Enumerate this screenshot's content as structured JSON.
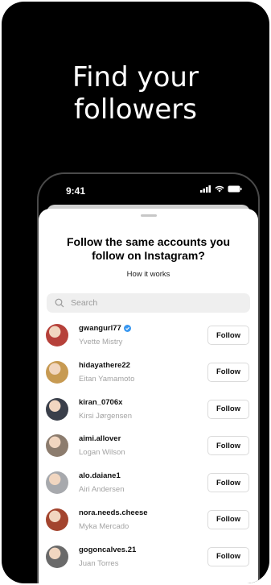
{
  "promo": {
    "headline_line1": "Find your",
    "headline_line2": "followers"
  },
  "status_bar": {
    "time": "9:41"
  },
  "sheet": {
    "title_line1": "Follow the same accounts you",
    "title_line2": "follow on Instagram?",
    "how_it_works": "How it works",
    "search_placeholder": "Search"
  },
  "accounts": [
    {
      "username": "gwangurl77",
      "name": "Yvette Mistry",
      "verified": true,
      "button": "Follow",
      "avatar_color": "#b6413a"
    },
    {
      "username": "hidayathere22",
      "name": "Eitan Yamamoto",
      "verified": false,
      "button": "Follow",
      "avatar_color": "#c79a52"
    },
    {
      "username": "kiran_0706x",
      "name": "Kirsi Jørgensen",
      "verified": false,
      "button": "Follow",
      "avatar_color": "#3a3f4a"
    },
    {
      "username": "aimi.allover",
      "name": "Logan Wilson",
      "verified": false,
      "button": "Follow",
      "avatar_color": "#8c7c6e"
    },
    {
      "username": "alo.daiane1",
      "name": "Airi Andersen",
      "verified": false,
      "button": "Follow",
      "avatar_color": "#a7a9ad"
    },
    {
      "username": "nora.needs.cheese",
      "name": "Myka Mercado",
      "verified": false,
      "button": "Follow",
      "avatar_color": "#a3442e"
    },
    {
      "username": "gogoncalves.21",
      "name": "Juan Torres",
      "verified": false,
      "button": "Follow",
      "avatar_color": "#6a6a6a"
    }
  ],
  "colors": {
    "background": "#000000",
    "verified_blue": "#3897f0",
    "subtext": "#a3a3a3"
  }
}
